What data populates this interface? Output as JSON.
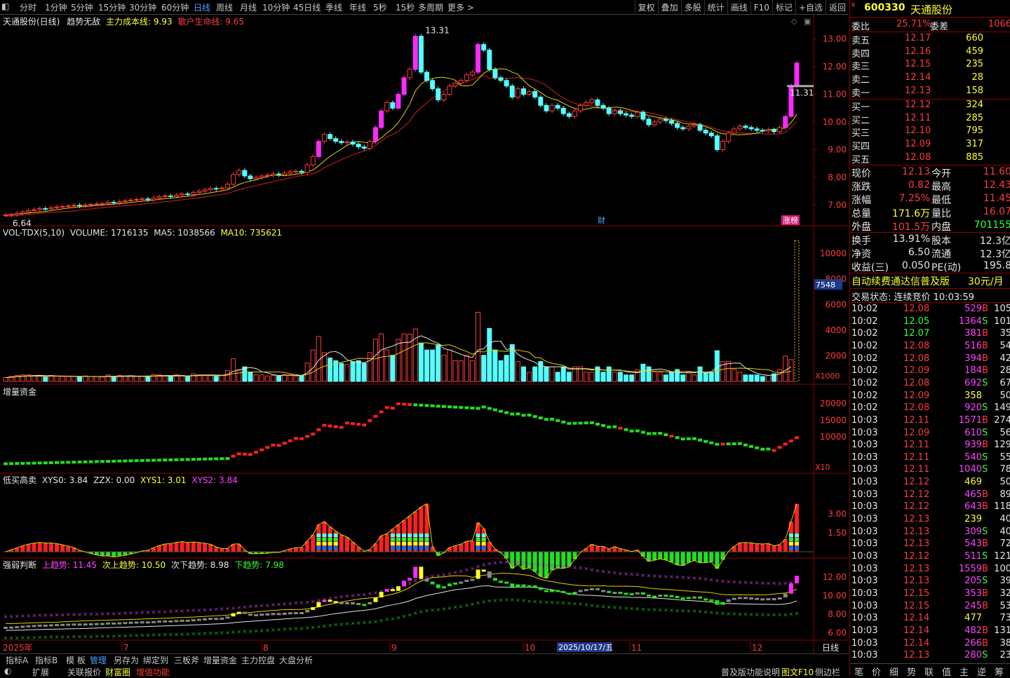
{
  "toolbar": {
    "left_tabs": [
      "分时",
      "1分钟",
      "5分钟",
      "15分钟",
      "30分钟",
      "60分钟",
      "日线",
      "周线",
      "月线",
      "10分钟",
      "45日线",
      "季线",
      "年线",
      "5秒",
      "15秒",
      "多周期",
      "更多 >"
    ],
    "active_tab": "日线",
    "right_tools": [
      "复权",
      "叠加",
      "多股",
      "统计",
      "画线",
      "F10",
      "标记",
      "+自选",
      "返回"
    ]
  },
  "stock": {
    "code": "600330",
    "name": "天通股份",
    "badge": "R"
  },
  "main_panel": {
    "title": "天通股份(日线)",
    "indicator": "趋势无敌",
    "line1": "主力成本线: 9.93",
    "line2": "散户生命线: 9.65",
    "high_label": "13.31",
    "low_label": "6.64",
    "price_tag": "11.31",
    "marker_cai": "财",
    "marker_zb": "涨榜",
    "y_ticks": [
      "13.00",
      "12.00",
      "11.00",
      "10.00",
      "9.00",
      "8.00",
      "7.00"
    ]
  },
  "vol_panel": {
    "title": "VOL-TDX(5,10)",
    "volume": "VOLUME: 1716135",
    "ma5": "MA5: 1038566",
    "ma10": "MA10: 735621",
    "y_ticks": [
      "10000",
      "8000",
      "6000",
      "4000",
      "2000"
    ],
    "tag": "7548",
    "unit": "X1000"
  },
  "fund_panel": {
    "title": "增量资金",
    "y_ticks": [
      "20000",
      "15000",
      "10000"
    ],
    "unit": "X10"
  },
  "buy_panel": {
    "title": "低买高卖",
    "v0": "XYS0: 3.84",
    "v1": "ZZX: 0.00",
    "v2": "XYS1: 3.01",
    "v3": "XYS2: 3.84",
    "y_ticks": [
      "3.00",
      "1.50"
    ]
  },
  "trend_panel": {
    "title": "强弱判断",
    "up": "上趋势: 11.45",
    "subup": "次上趋势: 10.50",
    "subdown": "次下趋势: 8.98",
    "down": "下趋势: 7.98",
    "y_ticks": [
      "12.00",
      "10.00",
      "8.00",
      "6.00"
    ]
  },
  "date_axis": {
    "year": "2025年",
    "months": [
      "7",
      "8",
      "9",
      "10",
      "11",
      "12"
    ],
    "highlight": "2025/10/17/五",
    "right": "日线"
  },
  "quote": {
    "webi_label": "委比",
    "webi": "25.71%",
    "weicha_label": "委差",
    "weicha": "1066",
    "asks": [
      {
        "l": "卖五",
        "p": "12.17",
        "v": "660"
      },
      {
        "l": "卖四",
        "p": "12.16",
        "v": "459"
      },
      {
        "l": "卖三",
        "p": "12.15",
        "v": "235"
      },
      {
        "l": "卖二",
        "p": "12.14",
        "v": "28"
      },
      {
        "l": "卖一",
        "p": "12.13",
        "v": "158"
      }
    ],
    "bids": [
      {
        "l": "买一",
        "p": "12.12",
        "v": "324"
      },
      {
        "l": "买二",
        "p": "12.11",
        "v": "285"
      },
      {
        "l": "买三",
        "p": "12.10",
        "v": "795"
      },
      {
        "l": "买四",
        "p": "12.09",
        "v": "317"
      },
      {
        "l": "买五",
        "p": "12.08",
        "v": "885"
      }
    ],
    "stats": [
      {
        "l1": "现价",
        "v1": "12.13",
        "l2": "今开",
        "v2": "11.60"
      },
      {
        "l1": "涨跌",
        "v1": "0.82",
        "l2": "最高",
        "v2": "12.43"
      },
      {
        "l1": "涨幅",
        "v1": "7.25%",
        "l2": "最低",
        "v2": "11.45"
      },
      {
        "l1": "总量",
        "v1": "171.6万",
        "l2": "量比",
        "v2": "16.07"
      },
      {
        "l1": "外盘",
        "v1": "101.5万",
        "l2": "内盘",
        "v2": "701155"
      }
    ],
    "stats2": [
      {
        "l1": "换手",
        "v1": "13.91%",
        "l2": "股本",
        "v2": "12.3亿"
      },
      {
        "l1": "净资",
        "v1": "6.50",
        "l2": "流通",
        "v2": "12.3亿"
      },
      {
        "l1": "收益(三)",
        "v1": "0.050",
        "l2": "PE(动)",
        "v2": "195.8"
      }
    ],
    "ad": "自动续费通达信普及版",
    "ad_price": "30元/月",
    "status": "交易状态: 连续竞价 10:03:59"
  },
  "ticks": [
    [
      "10:02",
      "12.08",
      "529",
      "B",
      "105"
    ],
    [
      "10:02",
      "12.05",
      "1364",
      "S",
      "101"
    ],
    [
      "10:02",
      "12.07",
      "381",
      "B",
      "35"
    ],
    [
      "10:02",
      "12.08",
      "516",
      "B",
      "54"
    ],
    [
      "10:02",
      "12.08",
      "394",
      "B",
      "42"
    ],
    [
      "10:02",
      "12.09",
      "184",
      "B",
      "28"
    ],
    [
      "10:02",
      "12.08",
      "692",
      "S",
      "67"
    ],
    [
      "10:02",
      "12.09",
      "358",
      "",
      "50"
    ],
    [
      "10:02",
      "12.08",
      "920",
      "S",
      "149"
    ],
    [
      "10:03",
      "12.11",
      "1571",
      "B",
      "274"
    ],
    [
      "10:03",
      "12.09",
      "610",
      "S",
      "56"
    ],
    [
      "10:03",
      "12.11",
      "939",
      "B",
      "129"
    ],
    [
      "10:03",
      "12.11",
      "540",
      "S",
      "55"
    ],
    [
      "10:03",
      "12.11",
      "1040",
      "S",
      "78"
    ],
    [
      "10:03",
      "12.12",
      "469",
      "",
      "50"
    ],
    [
      "10:03",
      "12.12",
      "465",
      "B",
      "89"
    ],
    [
      "10:03",
      "12.12",
      "643",
      "B",
      "118"
    ],
    [
      "10:03",
      "12.13",
      "239",
      "",
      "40"
    ],
    [
      "10:03",
      "12.13",
      "309",
      "S",
      "40"
    ],
    [
      "10:03",
      "12.13",
      "543",
      "B",
      "72"
    ],
    [
      "10:03",
      "12.12",
      "511",
      "S",
      "121"
    ],
    [
      "10:03",
      "12.13",
      "1559",
      "B",
      "100"
    ],
    [
      "10:03",
      "12.13",
      "205",
      "S",
      "39"
    ],
    [
      "10:03",
      "12.15",
      "353",
      "B",
      "32"
    ],
    [
      "10:03",
      "12.15",
      "245",
      "B",
      "53"
    ],
    [
      "10:03",
      "12.14",
      "477",
      "",
      "73"
    ],
    [
      "10:03",
      "12.14",
      "482",
      "B",
      "131"
    ],
    [
      "10:03",
      "12.14",
      "266",
      "B",
      "38"
    ],
    [
      "10:03",
      "12.13",
      "280",
      "S",
      "23"
    ]
  ],
  "bottom_tabs": [
    "指标A",
    "指标B",
    "模 板",
    "管理",
    "另存为",
    "绑定到",
    "三板斧",
    "增量资金",
    "主力控盘",
    "大盘分析"
  ],
  "bottom_tabs2": [
    "扩展",
    "关联报价",
    "财富圈",
    "增值功能"
  ],
  "bottom_right": [
    "普及版功能说明",
    "图文F10",
    "侧边栏"
  ],
  "side_bottom": [
    "笔",
    "价",
    "细",
    "势",
    "联",
    "值",
    "主",
    "逆",
    "筹"
  ],
  "chart_data": {
    "type": "candlestick",
    "close": [
      6.64,
      6.66,
      6.7,
      6.75,
      6.8,
      6.83,
      6.87,
      6.86,
      6.9,
      6.93,
      6.95,
      6.97,
      6.99,
      6.97,
      7.0,
      7.02,
      7.04,
      7.05,
      7.1,
      7.08,
      7.12,
      7.15,
      7.18,
      7.2,
      7.22,
      7.19,
      7.25,
      7.3,
      7.33,
      7.31,
      7.36,
      7.4,
      7.38,
      7.45,
      7.5,
      7.55,
      7.6,
      7.58,
      7.62,
      7.75,
      8.1,
      8.25,
      8.05,
      7.95,
      8.0,
      8.05,
      8.08,
      8.12,
      8.09,
      8.15,
      8.2,
      8.22,
      8.18,
      8.45,
      8.75,
      9.3,
      9.55,
      9.4,
      9.3,
      9.25,
      9.28,
      9.2,
      9.1,
      9.05,
      9.3,
      9.8,
      10.4,
      10.7,
      10.5,
      11.0,
      11.6,
      11.9,
      13.1,
      11.8,
      11.5,
      11.2,
      10.8,
      11.0,
      11.3,
      11.4,
      11.5,
      11.7,
      11.8,
      12.8,
      12.6,
      11.9,
      11.6,
      11.5,
      11.3,
      10.9,
      11.2,
      11.0,
      11.1,
      10.9,
      10.6,
      10.4,
      10.6,
      10.5,
      10.3,
      10.2,
      10.4,
      10.6,
      10.7,
      10.8,
      10.6,
      10.5,
      10.3,
      10.4,
      10.3,
      10.25,
      10.2,
      10.35,
      10.1,
      9.9,
      10.0,
      10.1,
      10.05,
      9.95,
      9.8,
      9.75,
      9.85,
      9.9,
      9.7,
      9.6,
      9.5,
      9.0,
      9.3,
      9.6,
      9.75,
      9.85,
      9.8,
      9.75,
      9.7,
      9.68,
      9.72,
      9.65,
      9.8,
      10.2,
      11.31,
      12.13
    ]
  }
}
